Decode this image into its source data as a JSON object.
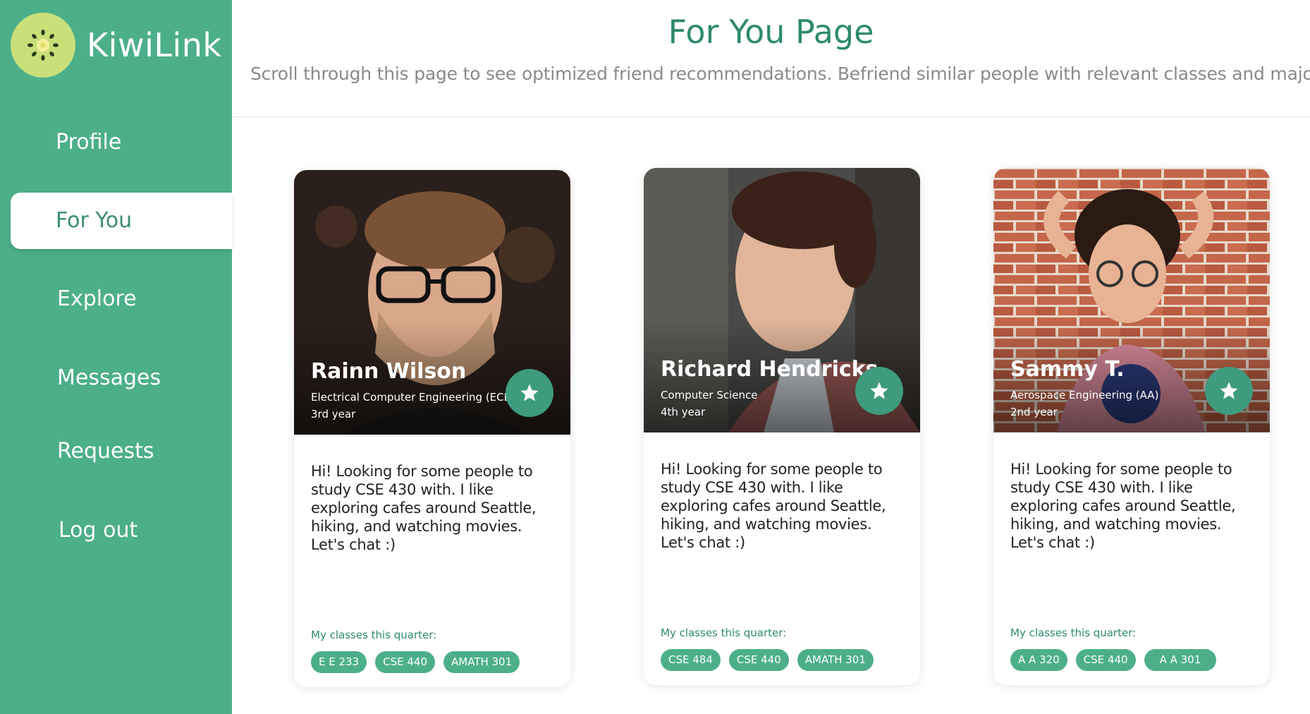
{
  "app": {
    "name": "KiwiLink",
    "logo_icon": "kiwi-icon"
  },
  "colors": {
    "sidebar": "#4caf8a",
    "accent": "#2e8a6f",
    "chip": "#4caf8a",
    "star_button": "#3f9b7e"
  },
  "nav": {
    "items": [
      {
        "label": "Profile"
      },
      {
        "label": "For You",
        "active": true
      },
      {
        "label": "Explore"
      },
      {
        "label": "Messages"
      },
      {
        "label": "Requests"
      },
      {
        "label": "Log out"
      }
    ]
  },
  "header": {
    "title": "For You Page",
    "subtitle": "Scroll through this page to see optimized friend recommendations. Befriend similar people with relevant classes and majors"
  },
  "cards": [
    {
      "name": "Rainn Wilson",
      "major": "Electrical Computer Engineering (ECE)",
      "year": "3rd year",
      "bio": "Hi! Looking for some people to study CSE 430 with. I like exploring cafes around Seattle, hiking, and watching movies. Let's chat :)",
      "classes_label": "My classes this quarter:",
      "classes": [
        "E E 233",
        "CSE 440",
        "AMATH 301"
      ]
    },
    {
      "name": "Richard Hendricks",
      "major": "Computer Science",
      "year": "4th year",
      "bio": "Hi! Looking for some people to study CSE 430 with. I like exploring cafes around Seattle, hiking, and watching movies. Let's chat :)",
      "classes_label": "My classes this quarter:",
      "classes": [
        "CSE 484",
        "CSE 440",
        "AMATH 301"
      ]
    },
    {
      "name": "Sammy T.",
      "major": "Aerospace Engineering (AA)",
      "year": "2nd year",
      "bio": "Hi! Looking for some people to study CSE 430 with. I like exploring cafes around Seattle, hiking, and watching movies. Let's chat :)",
      "classes_label": "My classes this quarter:",
      "classes": [
        "A A 320",
        "CSE 440",
        "A A 301"
      ]
    }
  ]
}
